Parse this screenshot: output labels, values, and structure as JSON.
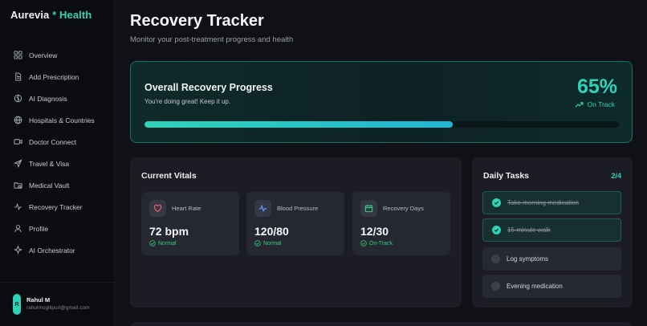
{
  "brand": {
    "part1": "Aurevia",
    "separator": "*",
    "part2": "Health"
  },
  "sidebar": {
    "items": [
      {
        "label": "Overview",
        "icon": "grid-icon"
      },
      {
        "label": "Add Prescription",
        "icon": "file-text-icon"
      },
      {
        "label": "AI Diagnosis",
        "icon": "brain-icon"
      },
      {
        "label": "Hospitals & Countries",
        "icon": "globe-icon"
      },
      {
        "label": "Doctor Connect",
        "icon": "video-icon"
      },
      {
        "label": "Travel & Visa",
        "icon": "plane-icon"
      },
      {
        "label": "Medical Vault",
        "icon": "folder-lock-icon"
      },
      {
        "label": "Recovery Tracker",
        "icon": "activity-icon"
      },
      {
        "label": "Profile",
        "icon": "user-icon"
      },
      {
        "label": "AI Orchestrator",
        "icon": "sparkles-icon"
      }
    ]
  },
  "user": {
    "initial": "R",
    "name": "Rahul M",
    "email": "rahulmogilipuri@gmail.com"
  },
  "page": {
    "title": "Recovery Tracker",
    "subtitle": "Monitor your post-treatment progress and health"
  },
  "progress": {
    "title": "Overall Recovery Progress",
    "subtitle": "You're doing great! Keep it up.",
    "percent_label": "65%",
    "percent": 65,
    "status": "On Track"
  },
  "vitals": {
    "heading": "Current Vitals",
    "items": [
      {
        "label": "Heart Rate",
        "value": "72 bpm",
        "status": "Normal",
        "icon": "heart-icon"
      },
      {
        "label": "Blood Pressure",
        "value": "120/80",
        "status": "Normal",
        "icon": "pulse-icon"
      },
      {
        "label": "Recovery Days",
        "value": "12/30",
        "status": "On-Track",
        "icon": "calendar-icon"
      }
    ]
  },
  "tasks": {
    "heading": "Daily Tasks",
    "count": "2/4",
    "items": [
      {
        "label": "Take morning medication",
        "done": true
      },
      {
        "label": "15-minute walk",
        "done": true
      },
      {
        "label": "Log symptoms",
        "done": false
      },
      {
        "label": "Evening medication",
        "done": false
      }
    ]
  },
  "colors": {
    "accent": "#2ed3b7",
    "status_good": "#36d07f",
    "background": "#101116",
    "card": "#1b1c24"
  }
}
